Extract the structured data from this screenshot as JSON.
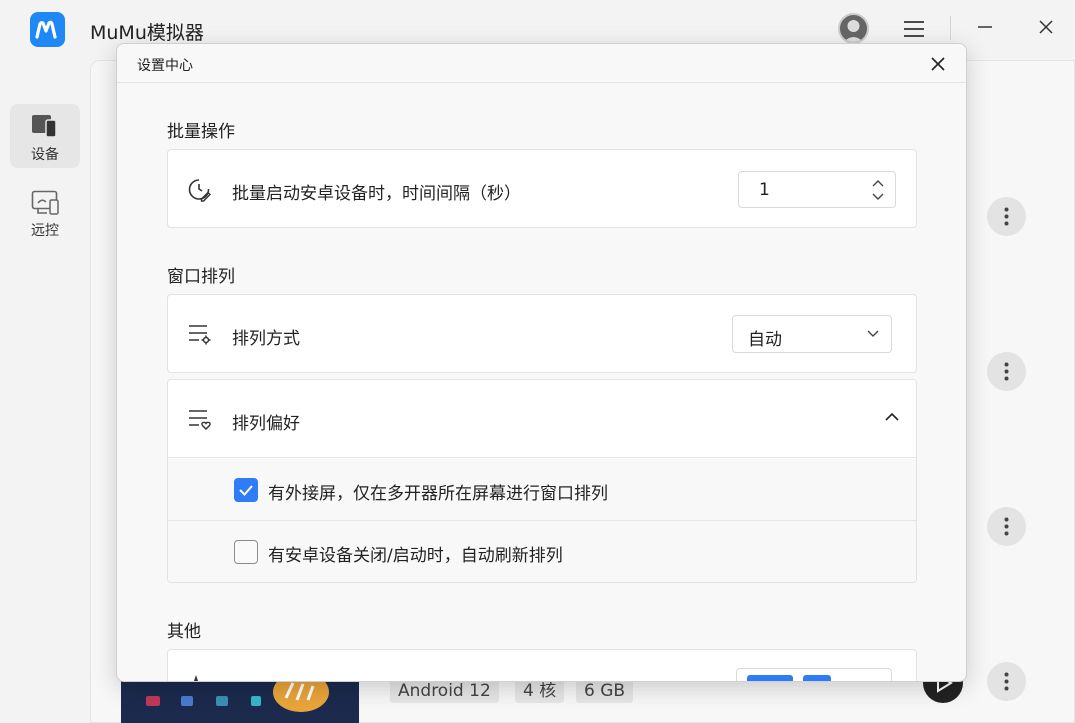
{
  "app": {
    "title": "MuMu模拟器"
  },
  "sidebar": {
    "items": [
      {
        "label": "设备",
        "active": true
      },
      {
        "label": "远控",
        "active": false
      }
    ]
  },
  "background": {
    "device_tags": [
      "Android 12",
      "4 核",
      "6 GB"
    ]
  },
  "dialog": {
    "title": "设置中心",
    "sections": {
      "batch": {
        "title": "批量操作",
        "interval_label": "批量启动安卓设备时，时间间隔（秒）",
        "interval_value": "1"
      },
      "window": {
        "title": "窗口排列",
        "arrange_label": "排列方式",
        "arrange_value": "自动",
        "pref_label": "排列偏好",
        "options": [
          {
            "label": "有外接屏，仅在多开器所在屏幕进行窗口排列",
            "checked": true
          },
          {
            "label": "有安卓设备关闭/启动时，自动刷新排列",
            "checked": false
          }
        ]
      },
      "other": {
        "title": "其他"
      }
    }
  },
  "colors": {
    "accent": "#2e7cf6",
    "logo": "#1e88f5"
  }
}
